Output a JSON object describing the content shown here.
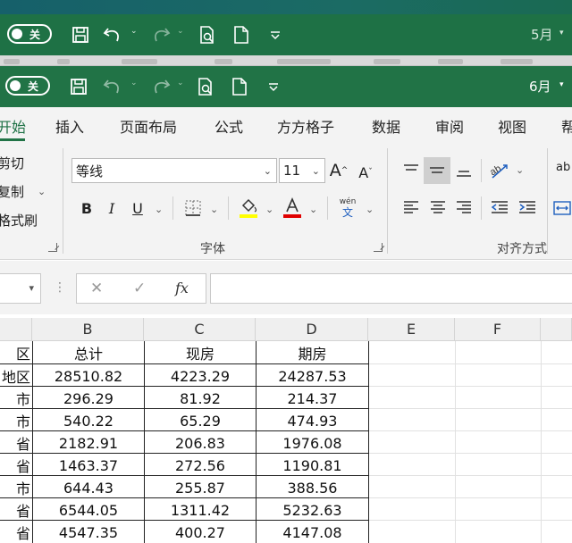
{
  "background_window": {
    "toggle_label": "关",
    "month": "5月"
  },
  "titlebar": {
    "toggle_label": "关",
    "month": "6月",
    "quick_access": [
      "save-icon",
      "undo-icon",
      "redo-icon",
      "print-preview-icon",
      "new-file-icon",
      "customize-icon"
    ]
  },
  "tabs": [
    "开始",
    "插入",
    "页面布局",
    "公式",
    "方方格子",
    "数据",
    "审阅",
    "视图",
    "帮"
  ],
  "clipboard": {
    "cut": "剪切",
    "copy": "复制",
    "format_painter": "格式刷"
  },
  "font_group": {
    "label": "字体",
    "font_name": "等线",
    "font_size": "11",
    "grow": "A",
    "shrink": "A",
    "bold": "B",
    "italic": "I",
    "underline": "U",
    "phonetic_top": "wén",
    "phonetic_bottom": "文",
    "highlight_color": "#ffff00",
    "font_color": "#e00000"
  },
  "alignment_group": {
    "label": "对齐方式",
    "wrap": "ab"
  },
  "formula_bar": {
    "cancel": "✕",
    "enter": "✓",
    "fx": "fx",
    "value": ""
  },
  "sheet": {
    "columns": [
      "B",
      "C",
      "D",
      "E",
      "F"
    ],
    "rows": [
      [
        "区",
        "总计",
        "现房",
        "期房"
      ],
      [
        "地区",
        "28510.82",
        "4223.29",
        "24287.53"
      ],
      [
        "市",
        "296.29",
        "81.92",
        "214.37"
      ],
      [
        "市",
        "540.22",
        "65.29",
        "474.93"
      ],
      [
        "省",
        "2182.91",
        "206.83",
        "1976.08"
      ],
      [
        "省",
        "1463.37",
        "272.56",
        "1190.81"
      ],
      [
        "市",
        "644.43",
        "255.87",
        "388.56"
      ],
      [
        "省",
        "6544.05",
        "1311.42",
        "5232.63"
      ],
      [
        "省",
        "4547.35",
        "400.27",
        "4147.08"
      ]
    ]
  },
  "colors": {
    "excel_green": "#217346",
    "ribbon_bg": "#f3f3f3"
  }
}
